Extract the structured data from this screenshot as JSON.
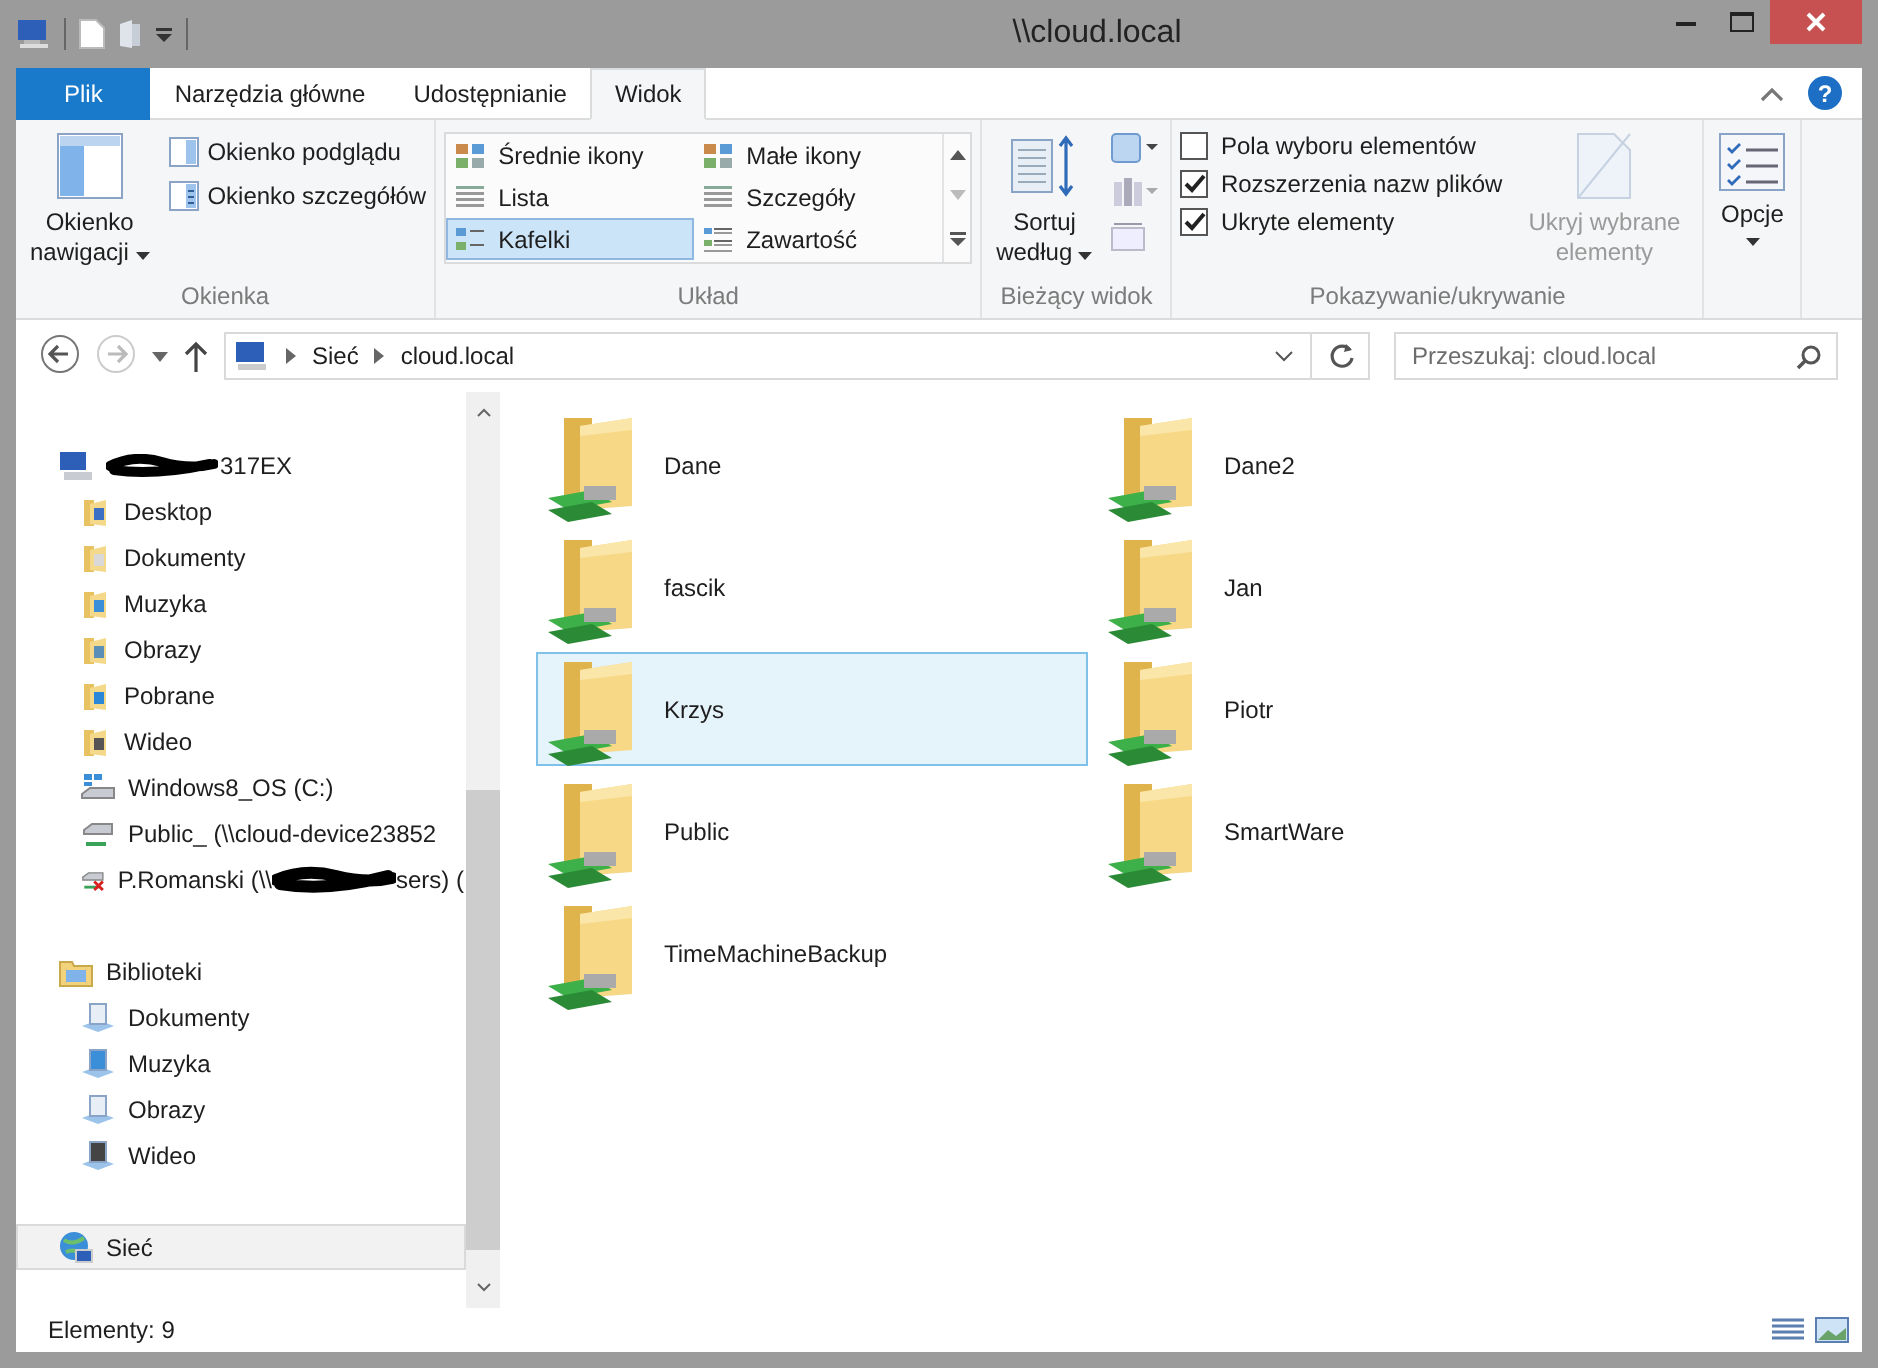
{
  "window": {
    "title": "\\\\cloud.local",
    "help": "?"
  },
  "ribbon_tabs": [
    {
      "label": "Plik",
      "kind": "file",
      "selected": false
    },
    {
      "label": "Narzędzia główne",
      "kind": "tab",
      "selected": false
    },
    {
      "label": "Udostępnianie",
      "kind": "tab",
      "selected": false
    },
    {
      "label": "Widok",
      "kind": "tab",
      "selected": true
    }
  ],
  "ribbon": {
    "panes": {
      "large_button": {
        "lines": [
          "Okienko",
          "nawigacji"
        ]
      },
      "buttons": [
        {
          "label": "Okienko podglądu",
          "kind": "preview"
        },
        {
          "label": "Okienko szczegółów",
          "kind": "details"
        }
      ],
      "label": "Okienka"
    },
    "layout": {
      "options": [
        {
          "label": "Średnie ikony",
          "kind": "medium",
          "selected": false
        },
        {
          "label": "Małe ikony",
          "kind": "small",
          "selected": false
        },
        {
          "label": "Lista",
          "kind": "list",
          "selected": false
        },
        {
          "label": "Szczegóły",
          "kind": "details",
          "selected": false
        },
        {
          "label": "Kafelki",
          "kind": "tiles",
          "selected": true
        },
        {
          "label": "Zawartość",
          "kind": "content",
          "selected": false
        }
      ],
      "label": "Układ"
    },
    "current_view": {
      "sort_button": {
        "lines": [
          "Sortuj",
          "według"
        ]
      },
      "label": "Bieżący widok"
    },
    "show_hide": {
      "checkboxes": [
        {
          "label": "Pola wyboru elementów",
          "checked": false
        },
        {
          "label": "Rozszerzenia nazw plików",
          "checked": true
        },
        {
          "label": "Ukryte elementy",
          "checked": true
        }
      ],
      "hide_button": {
        "lines": [
          "Ukryj wybrane",
          "elementy"
        ],
        "disabled": true
      },
      "label": "Pokazywanie/ukrywanie"
    },
    "options": {
      "label": "Opcje"
    }
  },
  "address": {
    "crumbs": [
      "Sieć",
      "cloud.local"
    ],
    "search_placeholder": "Przeszukaj: cloud.local"
  },
  "nav": [
    {
      "label": "317EX",
      "kind": "computer",
      "redacted": true,
      "selected": false,
      "children": [
        {
          "label": "Desktop",
          "kind": "folder-desktop",
          "selected": false
        },
        {
          "label": "Dokumenty",
          "kind": "folder-docs",
          "selected": false
        },
        {
          "label": "Muzyka",
          "kind": "folder-music",
          "selected": false
        },
        {
          "label": "Obrazy",
          "kind": "folder-pictures",
          "selected": false
        },
        {
          "label": "Pobrane",
          "kind": "folder-downloads",
          "selected": false
        },
        {
          "label": "Wideo",
          "kind": "folder-video",
          "selected": false
        },
        {
          "label": "Windows8_OS (C:)",
          "kind": "drive",
          "selected": false
        },
        {
          "label": "Public_ (\\\\cloud-device23852",
          "kind": "netdrive",
          "selected": false
        },
        {
          "label": "P.Romanski (\\\\",
          "label_after": "sers) (",
          "redacted": true,
          "kind": "netdrive-off",
          "selected": false
        }
      ]
    },
    {
      "label": "Biblioteki",
      "kind": "libraries",
      "selected": false,
      "children": [
        {
          "label": "Dokumenty",
          "kind": "lib-docs",
          "selected": false
        },
        {
          "label": "Muzyka",
          "kind": "lib-music",
          "selected": false
        },
        {
          "label": "Obrazy",
          "kind": "lib-pictures",
          "selected": false
        },
        {
          "label": "Wideo",
          "kind": "lib-video",
          "selected": false
        }
      ]
    },
    {
      "label": "Sieć",
      "kind": "network",
      "selected": true
    }
  ],
  "folders": [
    {
      "name": "Dane",
      "selected": false
    },
    {
      "name": "Dane2",
      "selected": false
    },
    {
      "name": "fascik",
      "selected": false
    },
    {
      "name": "Jan",
      "selected": false
    },
    {
      "name": "Krzys",
      "selected": true
    },
    {
      "name": "Piotr",
      "selected": false
    },
    {
      "name": "Public",
      "selected": false
    },
    {
      "name": "SmartWare",
      "selected": false
    },
    {
      "name": "TimeMachineBackup",
      "selected": false
    }
  ],
  "status_bar": {
    "count": "Elementy: 9"
  }
}
